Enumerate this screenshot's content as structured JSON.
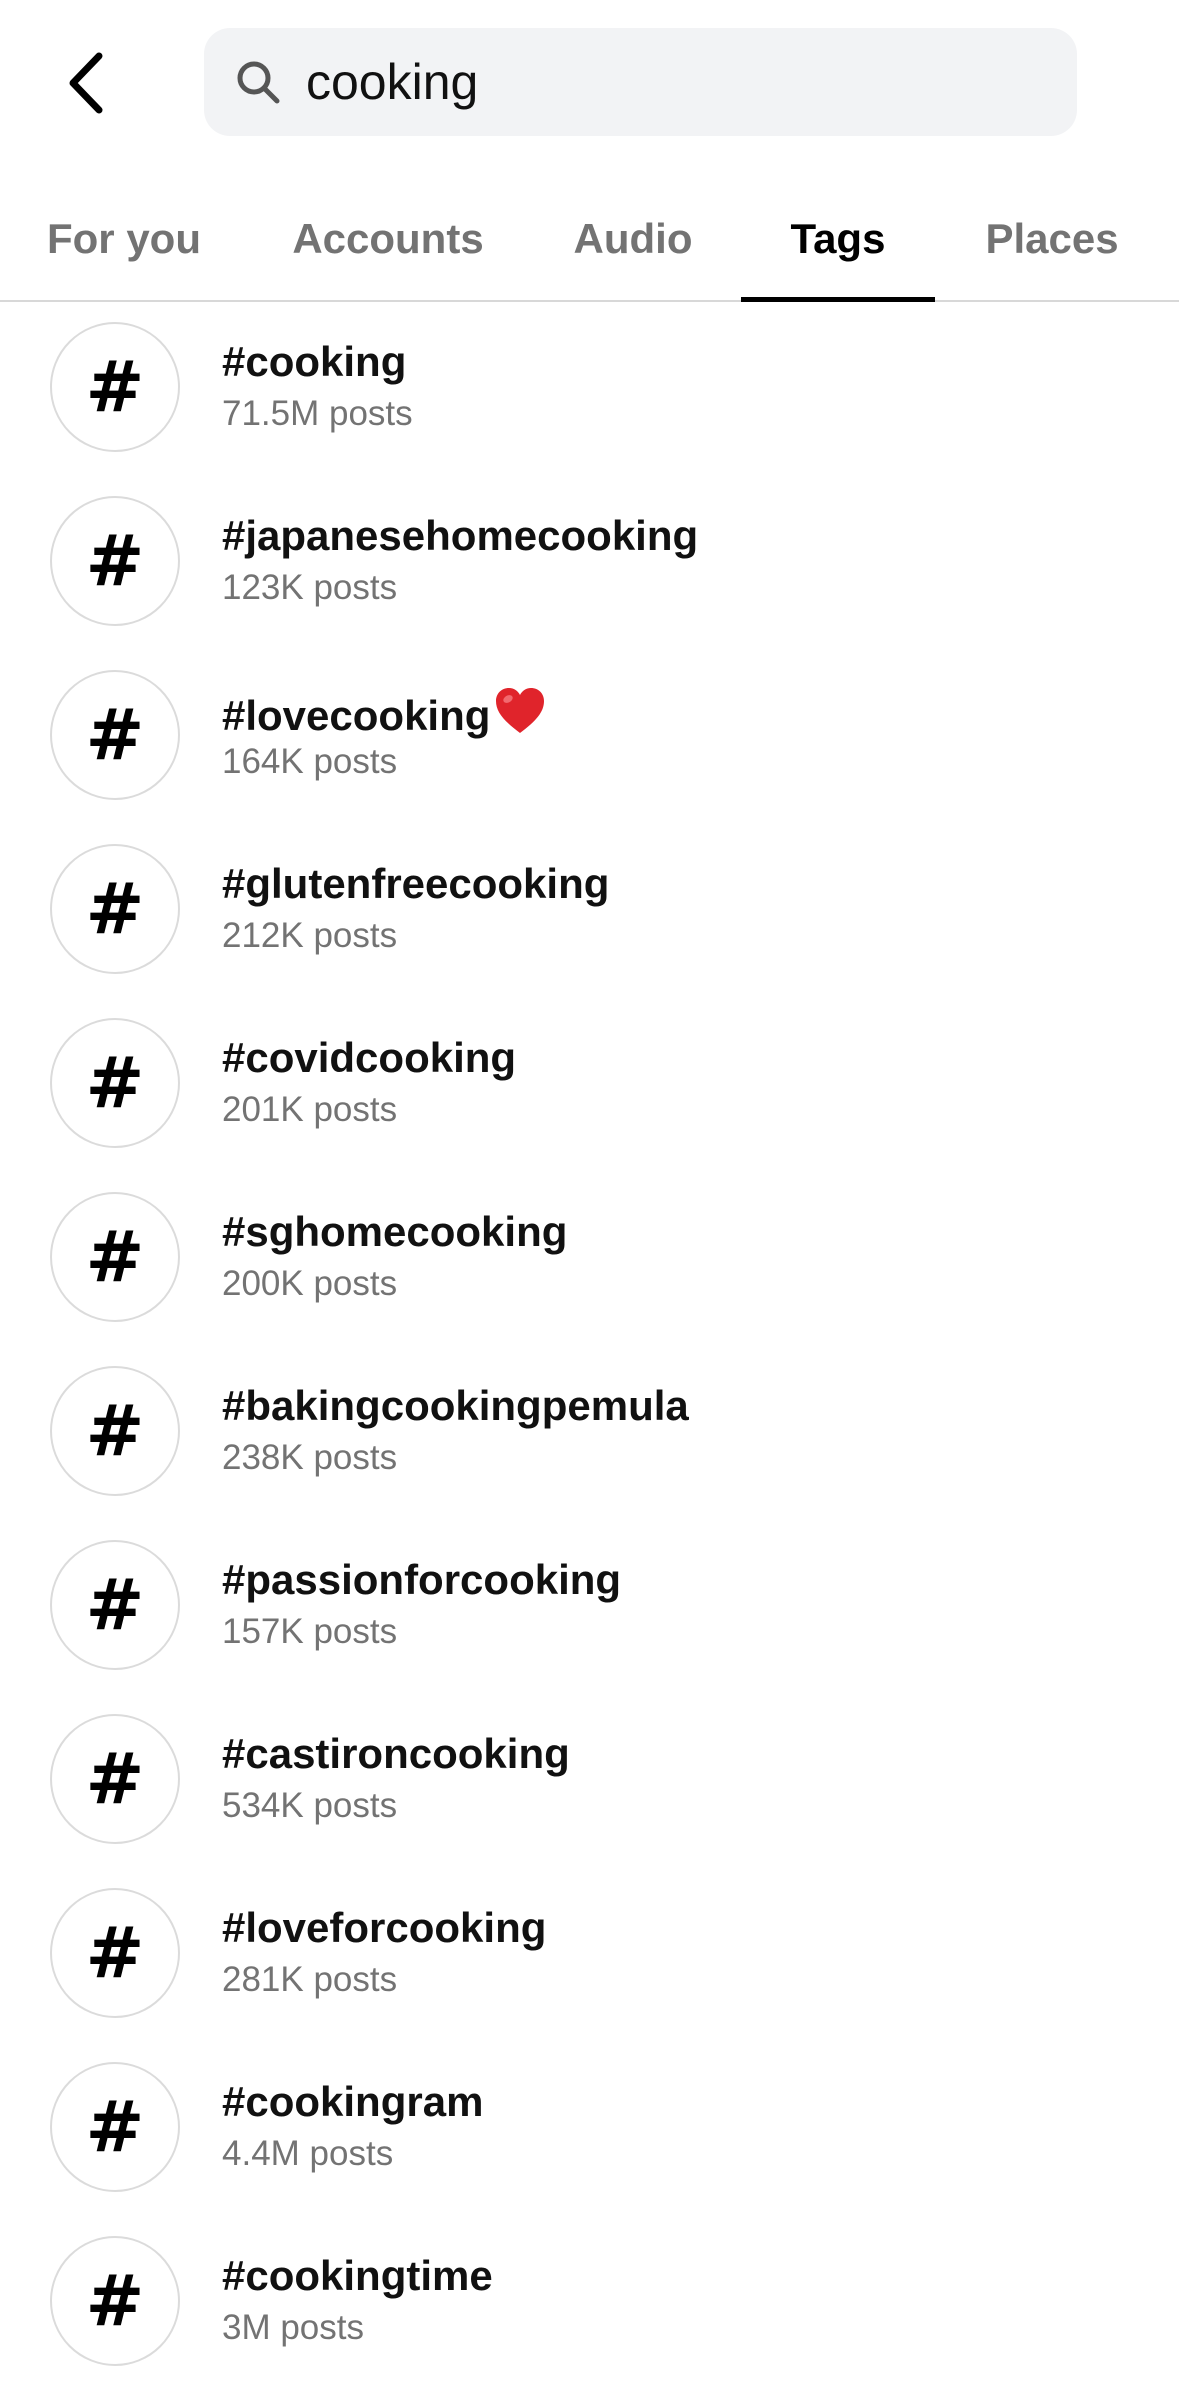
{
  "search": {
    "query": "cooking"
  },
  "tabs": [
    {
      "label": "For you",
      "active": false
    },
    {
      "label": "Accounts",
      "active": false
    },
    {
      "label": "Audio",
      "active": false
    },
    {
      "label": "Tags",
      "active": true
    },
    {
      "label": "Places",
      "active": false
    }
  ],
  "results": [
    {
      "tag": "#cooking",
      "count": "71.5M posts"
    },
    {
      "tag": "#japanesehomecooking",
      "count": "123K posts"
    },
    {
      "tag": "#lovecooking",
      "count": "164K posts",
      "emoji_icon": "red-heart-icon"
    },
    {
      "tag": "#glutenfreecooking",
      "count": "212K posts"
    },
    {
      "tag": "#covidcooking",
      "count": "201K posts"
    },
    {
      "tag": "#sghomecooking",
      "count": "200K posts"
    },
    {
      "tag": "#bakingcookingpemula",
      "count": "238K posts"
    },
    {
      "tag": "#passionforcooking",
      "count": "157K posts"
    },
    {
      "tag": "#castironcooking",
      "count": "534K posts"
    },
    {
      "tag": "#loveforcooking",
      "count": "281K posts"
    },
    {
      "tag": "#cookingram",
      "count": "4.4M posts"
    },
    {
      "tag": "#cookingtime",
      "count": "3M posts"
    }
  ],
  "colors": {
    "heart": "#e0242b",
    "muted_text": "#737373",
    "search_bg": "#f2f3f5"
  }
}
